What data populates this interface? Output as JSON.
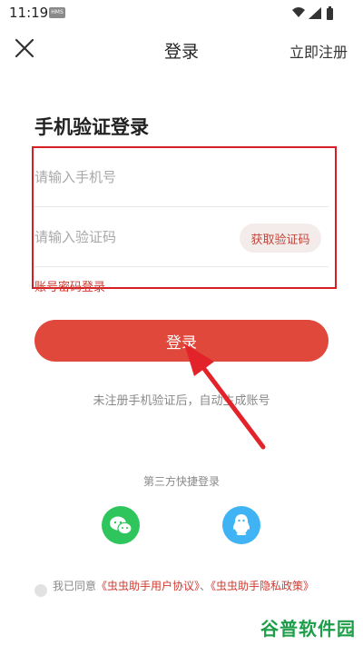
{
  "status_bar": {
    "time": "11:19",
    "badge": "HMS",
    "icons": [
      "wifi-icon",
      "signal-icon",
      "battery-icon"
    ]
  },
  "nav": {
    "title": "登录",
    "register_label": "立即注册",
    "close_icon": "close-icon"
  },
  "form": {
    "heading": "手机验证登录",
    "phone_placeholder": "请输入手机号",
    "phone_value": "",
    "code_placeholder": "请输入验证码",
    "code_value": "",
    "get_code_label": "获取验证码",
    "password_login_label": "账号密码登录",
    "login_label": "登录",
    "hint": "未注册手机验证后，自动生成账号"
  },
  "third_party": {
    "label": "第三方快捷登录",
    "providers": [
      {
        "icon": "wechat-icon",
        "color": "#2ec55d"
      },
      {
        "icon": "qq-icon",
        "color": "#3fb3f3"
      }
    ]
  },
  "agreement": {
    "prefix": "我已同意",
    "user_agreement": "《虫虫助手用户协议》",
    "separator": "、",
    "privacy_policy": "《虫虫助手隐私政策》"
  },
  "watermark": "谷普软件园",
  "colors": {
    "accent": "#e0483b",
    "link": "#d03a30",
    "annotation": "#d61e24"
  }
}
